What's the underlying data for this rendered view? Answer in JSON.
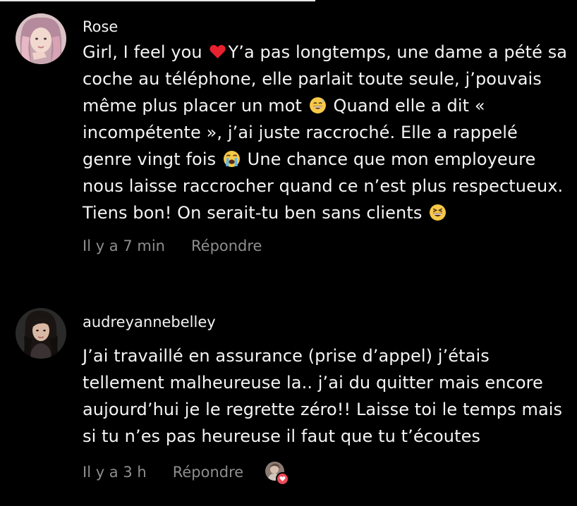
{
  "comments": [
    {
      "username": "Rose",
      "text_parts": [
        "Girl, I feel you ",
        "Y’a pas longtemps, une dame a pété sa coche au téléphone, elle parlait toute seule, j’pouvais même plus placer un mot ",
        " Quand elle a dit « incompétente », j’ai juste raccroché. Elle a rappelé genre vingt fois ",
        " Une chance que mon employeure nous laisse raccrocher quand ce n’est plus respectueux. Tiens bon! On serait-tu ben sans clients "
      ],
      "emojis": [
        "red-heart",
        "grinning-sweat",
        "loudly-crying",
        "laughing-squinting"
      ],
      "timestamp": "Il y a 7 min",
      "reply_label": "Répondre"
    },
    {
      "username": "audreyannebelley",
      "text": "J’ai travaillé en assurance (prise d’appel) j’étais tellement malheureuse la.. j’ai du quitter mais encore aujourd’hui je le regrette zéro!! Laisse toi le temps mais si tu n’es pas heureuse il faut que tu t’écoutes",
      "timestamp": "Il y a 3 h",
      "reply_label": "Répondre",
      "liked_by_author_icon": "heart-icon"
    }
  ],
  "colors": {
    "background": "#000000",
    "text": "#f5f5f5",
    "meta": "#8e8e8e",
    "heart": "#ed4956"
  }
}
